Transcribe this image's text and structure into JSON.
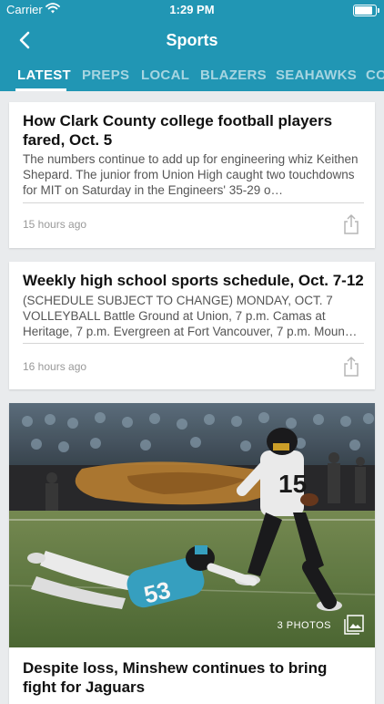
{
  "status_bar": {
    "carrier": "Carrier",
    "time": "1:29 PM",
    "battery_level": 0.95
  },
  "navbar": {
    "back_icon": "chevron-left-icon",
    "title": "Sports"
  },
  "tabs": [
    {
      "label": "LATEST",
      "active": true
    },
    {
      "label": "PREPS",
      "active": false
    },
    {
      "label": "LOCAL",
      "active": false
    },
    {
      "label": "BLAZERS",
      "active": false
    },
    {
      "label": "SEAHAWKS",
      "active": false
    },
    {
      "label": "CO",
      "active": false
    }
  ],
  "articles": [
    {
      "title": "How Clark County college football players fared, Oct. 5",
      "summary": "The numbers continue to add up for engineering whiz Keithen Shepard. The junior from Union High caught two touchdowns for MIT on Saturday in the Engineers' 35-29 o…",
      "time": "15 hours ago",
      "share_icon": "share-icon"
    },
    {
      "title": "Weekly high school sports schedule, Oct. 7-12",
      "summary": "(SCHEDULE SUBJECT TO CHANGE) MONDAY, OCT. 7 VOLLEYBALL Battle Ground at Union, 7 p.m. Camas at Heritage, 7 p.m. Evergreen at Fort Vancouver, 7 p.m. Moun…",
      "time": "16 hours ago",
      "share_icon": "share-icon"
    },
    {
      "title": "Despite loss, Minshew continues to bring fight for Jaguars",
      "photo_count": "3 PHOTOS",
      "gallery_icon": "photo-gallery-icon"
    }
  ],
  "colors": {
    "header": "#2196b4",
    "background": "#e9ebed",
    "jersey_white": "#f4f4f4",
    "jersey_teal": "#39a6c7"
  }
}
